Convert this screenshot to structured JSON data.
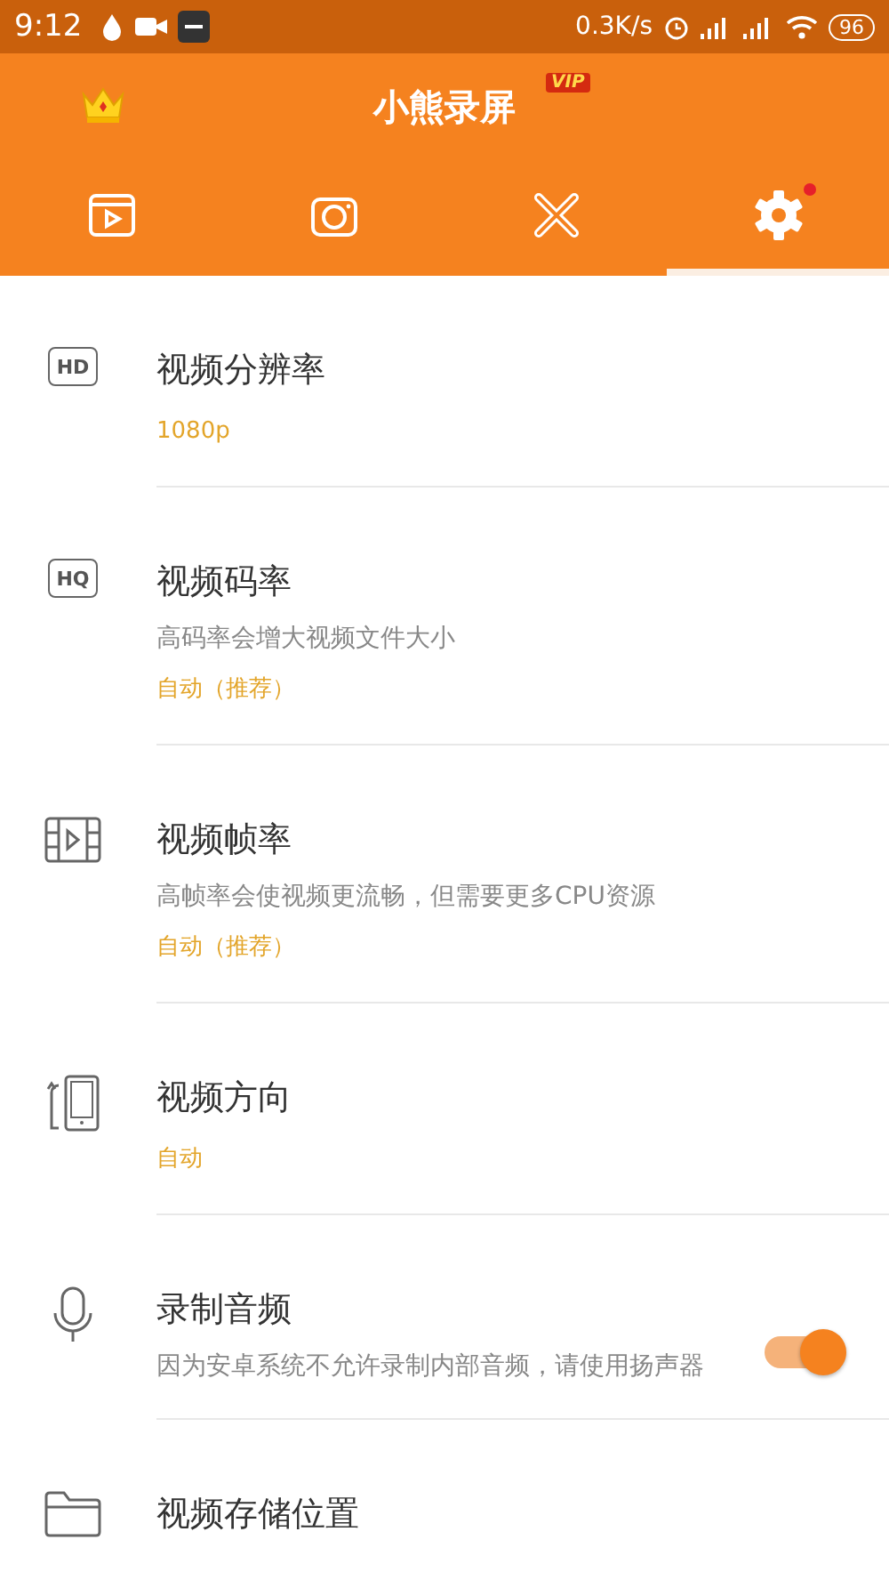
{
  "status_bar": {
    "time": "9:12",
    "speed": "0.3K/s",
    "battery": "96"
  },
  "header": {
    "title": "小熊录屏",
    "vip_badge": "VIP"
  },
  "tabs": [
    {
      "selected": false,
      "dot": false
    },
    {
      "selected": false,
      "dot": false
    },
    {
      "selected": false,
      "dot": false
    },
    {
      "selected": true,
      "dot": true
    }
  ],
  "settings": [
    {
      "kind": "value",
      "icon_text": "HD",
      "title": "视频分辨率",
      "value": "1080p"
    },
    {
      "kind": "value",
      "icon_text": "HQ",
      "title": "视频码率",
      "description": "高码率会增大视频文件大小",
      "value": "自动（推荐）"
    },
    {
      "kind": "value",
      "title": "视频帧率",
      "description": "高帧率会使视频更流畅，但需要更多CPU资源",
      "value": "自动（推荐）"
    },
    {
      "kind": "value",
      "title": "视频方向",
      "value": "自动"
    },
    {
      "kind": "toggle",
      "title": "录制音频",
      "description": "因为安卓系统不允许录制内部音频，请使用扬声器",
      "on": true
    },
    {
      "kind": "value",
      "title": "视频存储位置"
    }
  ]
}
